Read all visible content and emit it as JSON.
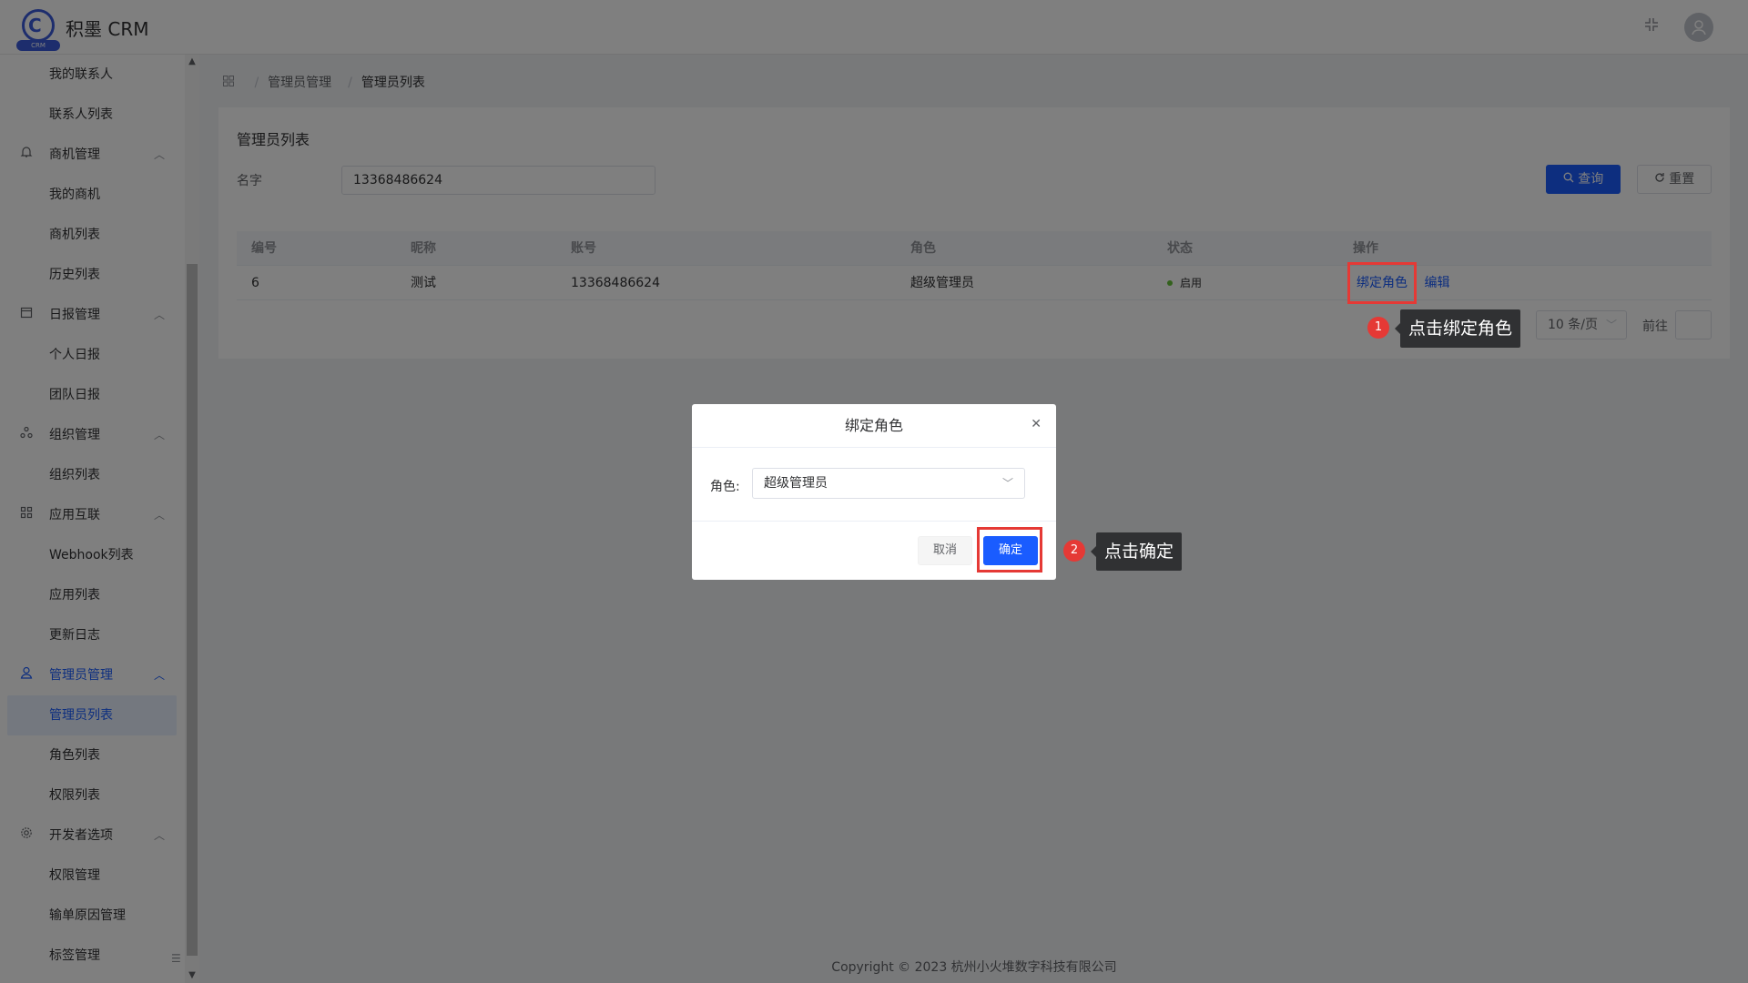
{
  "header": {
    "logo_band": "CRM",
    "logo_letter": "C",
    "app_title": "积墨 CRM",
    "fullscreen_icon": "compress-icon",
    "avatar_icon": "user-avatar-icon"
  },
  "sidebar": {
    "items": [
      {
        "label": "我的联系人",
        "type": "sub"
      },
      {
        "label": "联系人列表",
        "type": "sub"
      },
      {
        "label": "商机管理",
        "type": "group",
        "icon": "bell-icon"
      },
      {
        "label": "我的商机",
        "type": "sub"
      },
      {
        "label": "商机列表",
        "type": "sub"
      },
      {
        "label": "历史列表",
        "type": "sub"
      },
      {
        "label": "日报管理",
        "type": "group",
        "icon": "calendar-icon"
      },
      {
        "label": "个人日报",
        "type": "sub"
      },
      {
        "label": "团队日报",
        "type": "sub"
      },
      {
        "label": "组织管理",
        "type": "group",
        "icon": "org-icon"
      },
      {
        "label": "组织列表",
        "type": "sub"
      },
      {
        "label": "应用互联",
        "type": "group",
        "icon": "grid-icon"
      },
      {
        "label": "Webhook列表",
        "type": "sub"
      },
      {
        "label": "应用列表",
        "type": "sub"
      },
      {
        "label": "更新日志",
        "type": "sub"
      },
      {
        "label": "管理员管理",
        "type": "group",
        "icon": "user-icon",
        "active": true
      },
      {
        "label": "管理员列表",
        "type": "sub",
        "active": true
      },
      {
        "label": "角色列表",
        "type": "sub"
      },
      {
        "label": "权限列表",
        "type": "sub"
      },
      {
        "label": "开发者选项",
        "type": "group",
        "icon": "gear-icon"
      },
      {
        "label": "权限管理",
        "type": "sub"
      },
      {
        "label": "输单原因管理",
        "type": "sub"
      },
      {
        "label": "标签管理",
        "type": "sub"
      }
    ]
  },
  "breadcrumb": {
    "home_icon": "grid-icon",
    "level1": "管理员管理",
    "level2": "管理员列表"
  },
  "card": {
    "title": "管理员列表",
    "filter_label": "名字",
    "filter_value": "13368486624",
    "search_label": "查询",
    "reset_label": "重置"
  },
  "table": {
    "headers": [
      "编号",
      "昵称",
      "账号",
      "角色",
      "状态",
      "操作"
    ],
    "rows": [
      {
        "id": "6",
        "nickname": "测试",
        "account": "13368486624",
        "role": "超级管理员",
        "status": "启用",
        "action_bind": "绑定角色",
        "action_edit": "编辑"
      }
    ]
  },
  "pagination": {
    "page_size": "10 条/页",
    "goto_label": "前往"
  },
  "footer": {
    "copyright": "Copyright © 2023 杭州小火堆数字科技有限公司"
  },
  "dialog": {
    "title": "绑定角色",
    "role_label": "角色:",
    "role_value": "超级管理员",
    "cancel_label": "取消",
    "ok_label": "确定"
  },
  "annotations": [
    {
      "number": "1",
      "text": "点击绑定角色"
    },
    {
      "number": "2",
      "text": "点击确定"
    }
  ],
  "colors": {
    "primary": "#1a5cff",
    "highlight": "#e53935",
    "status_enabled": "#67c23a"
  }
}
